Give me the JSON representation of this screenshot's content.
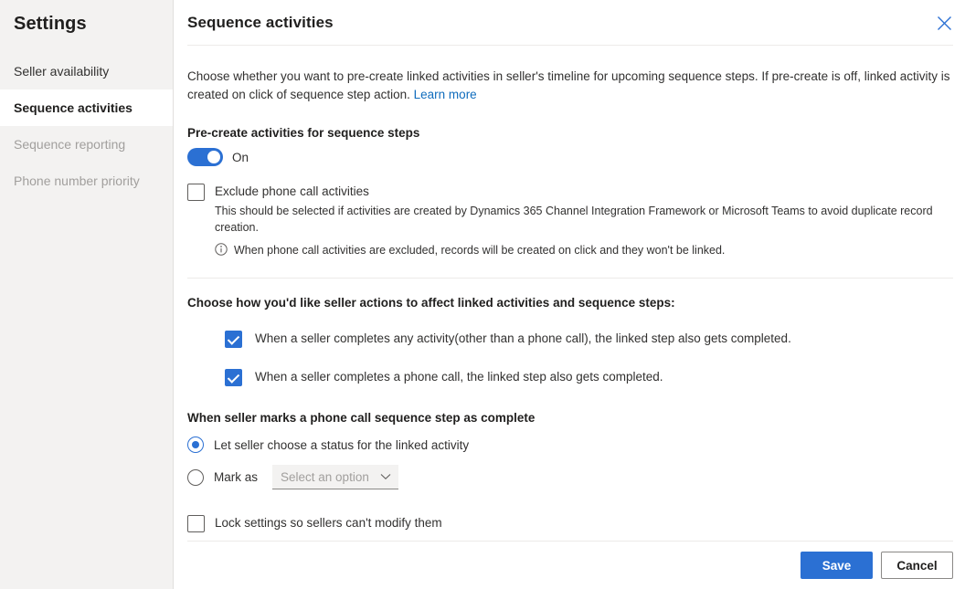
{
  "sidebar": {
    "title": "Settings",
    "items": [
      {
        "label": "Seller availability",
        "state": "normal"
      },
      {
        "label": "Sequence activities",
        "state": "selected"
      },
      {
        "label": "Sequence reporting",
        "state": "disabled"
      },
      {
        "label": "Phone number priority",
        "state": "disabled"
      }
    ]
  },
  "panel": {
    "title": "Sequence activities",
    "close_icon": "close-icon",
    "intro_text": "Choose whether you want to pre-create linked activities in seller's timeline for upcoming sequence steps. If pre-create is off, linked activity is created on click of sequence step action. ",
    "intro_link": "Learn more"
  },
  "precreate": {
    "label": "Pre-create activities for sequence steps",
    "toggle_state": "On",
    "toggle_on": true
  },
  "exclude": {
    "checkbox_label": "Exclude phone call activities",
    "checked": false,
    "description": "This should be selected if activities are created by Dynamics 365 Channel Integration Framework or Microsoft Teams to avoid duplicate record creation.",
    "info_icon": "info-icon",
    "info_text": "When phone call activities are excluded, records will be created on click and they won't be linked."
  },
  "seller_actions": {
    "heading": "Choose how you'd like seller actions to affect linked activities and sequence steps:",
    "options": [
      {
        "label": "When a seller completes any activity(other than a phone call), the linked step also gets completed.",
        "checked": true
      },
      {
        "label": "When a seller completes a phone call, the linked step also gets completed.",
        "checked": true
      }
    ]
  },
  "phone_complete": {
    "heading": "When seller marks a phone call sequence step as complete",
    "radio_let_seller": "Let seller choose a status for the linked activity",
    "radio_let_seller_selected": true,
    "radio_mark_as": "Mark as",
    "radio_mark_as_selected": false,
    "dropdown_value": "Select an option",
    "dropdown_icon": "chevron-down-icon"
  },
  "lock": {
    "label": "Lock settings so sellers can't modify them",
    "checked": false
  },
  "footer": {
    "save_label": "Save",
    "cancel_label": "Cancel"
  },
  "colors": {
    "accent": "#2b70d3",
    "link": "#0f6cbd",
    "sidebar_bg": "#f3f2f1",
    "divider": "#edebe9"
  }
}
